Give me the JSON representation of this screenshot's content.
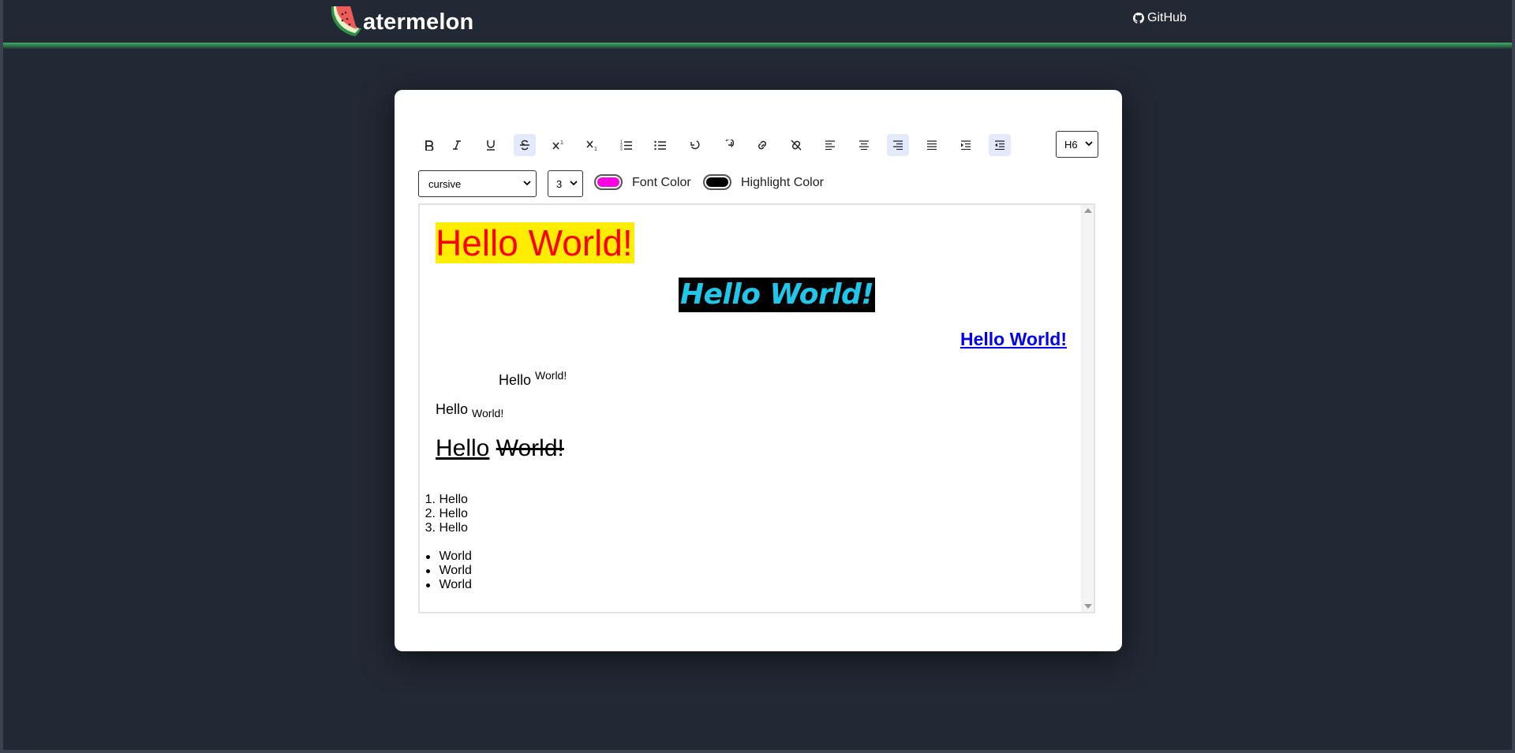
{
  "header": {
    "logo_text": "atermelon",
    "github_label": "GitHub"
  },
  "toolbar": {
    "buttons": [
      {
        "name": "bold-button",
        "icon": "bold-icon",
        "active": false
      },
      {
        "name": "italic-button",
        "icon": "italic-icon",
        "active": false
      },
      {
        "name": "underline-button",
        "icon": "underline-icon",
        "active": false
      },
      {
        "name": "strikethrough-button",
        "icon": "strikethrough-icon",
        "active": true
      },
      {
        "name": "superscript-button",
        "icon": "superscript-icon",
        "active": false
      },
      {
        "name": "subscript-button",
        "icon": "subscript-icon",
        "active": false
      },
      {
        "name": "ordered-list-button",
        "icon": "ordered-list-icon",
        "active": false
      },
      {
        "name": "unordered-list-button",
        "icon": "unordered-list-icon",
        "active": false
      },
      {
        "name": "undo-button",
        "icon": "undo-icon",
        "active": false
      },
      {
        "name": "redo-button",
        "icon": "redo-icon",
        "active": false
      },
      {
        "name": "link-button",
        "icon": "link-icon",
        "active": false
      },
      {
        "name": "unlink-button",
        "icon": "unlink-icon",
        "active": false
      },
      {
        "name": "align-left-button",
        "icon": "align-left-icon",
        "active": false
      },
      {
        "name": "align-center-button",
        "icon": "align-center-icon",
        "active": false
      },
      {
        "name": "align-right-button",
        "icon": "align-right-icon",
        "active": true
      },
      {
        "name": "justify-button",
        "icon": "justify-icon",
        "active": false
      },
      {
        "name": "indent-button",
        "icon": "indent-icon",
        "active": false
      },
      {
        "name": "outdent-button",
        "icon": "outdent-icon",
        "active": true
      }
    ],
    "heading_value": "H6",
    "font_family_value": "cursive",
    "font_size_value": "3",
    "font_color_label": "Font Color",
    "font_color": "#ff00e0",
    "highlight_color_label": "Highlight Color",
    "highlight_color": "#000000"
  },
  "editor": {
    "line1": "Hello World!",
    "line1_color": "#ff0000",
    "line1_highlight": "#ffed00",
    "line2": "Hello World!",
    "line2_color": "#1fc8ea",
    "line2_highlight": "#000000",
    "line3": "Hello World!",
    "line4_a": "Hello ",
    "line4_sup": "World!",
    "line5_a": "Hello ",
    "line5_sub": "World!",
    "line6_underline": "Hello",
    "line6_strike": "World!",
    "ordered_list": [
      "Hello",
      "Hello",
      "Hello"
    ],
    "unordered_list": [
      "World",
      "World",
      "World"
    ]
  }
}
